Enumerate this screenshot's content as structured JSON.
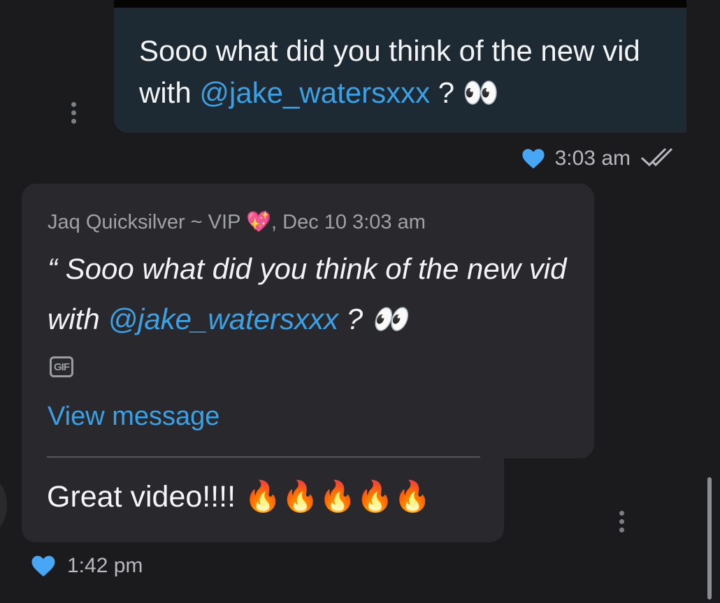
{
  "sent_message": {
    "text_before": "Sooo what did you think of the new vid with ",
    "mention": "@jake_watersxxx",
    "text_after": " ? ",
    "emoji": "👀",
    "time": "3:03 am",
    "read_status_icon": "double-check-icon",
    "liked_icon": "heart-icon"
  },
  "received_message": {
    "reply_header": "Jaq Quicksilver ~ VIP 💖, Dec 10 3:03 am",
    "quote_open": "“ ",
    "quote_text_before": "Sooo what did you think of the new vid with ",
    "quote_mention": "@jake_watersxxx",
    "quote_text_after": " ? ",
    "quote_emoji": "👀",
    "gif_label": "GIF",
    "view_message_label": "View message",
    "reply_text": "Great video!!!! ",
    "reply_emoji": "🔥🔥🔥🔥🔥",
    "time": "1:42 pm",
    "liked_icon": "heart-icon"
  },
  "colors": {
    "background": "#1b1b1d",
    "sent_bubble": "#1e2a33",
    "received_bubble": "#29292d",
    "accent": "#3aa1e6"
  }
}
